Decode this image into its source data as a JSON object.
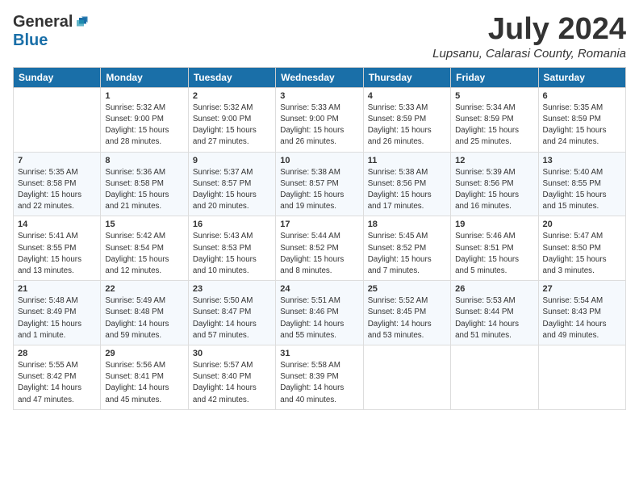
{
  "header": {
    "logo_general": "General",
    "logo_blue": "Blue",
    "month": "July 2024",
    "location": "Lupsanu, Calarasi County, Romania"
  },
  "days_of_week": [
    "Sunday",
    "Monday",
    "Tuesday",
    "Wednesday",
    "Thursday",
    "Friday",
    "Saturday"
  ],
  "weeks": [
    [
      {
        "day": "",
        "info": ""
      },
      {
        "day": "1",
        "info": "Sunrise: 5:32 AM\nSunset: 9:00 PM\nDaylight: 15 hours\nand 28 minutes."
      },
      {
        "day": "2",
        "info": "Sunrise: 5:32 AM\nSunset: 9:00 PM\nDaylight: 15 hours\nand 27 minutes."
      },
      {
        "day": "3",
        "info": "Sunrise: 5:33 AM\nSunset: 9:00 PM\nDaylight: 15 hours\nand 26 minutes."
      },
      {
        "day": "4",
        "info": "Sunrise: 5:33 AM\nSunset: 8:59 PM\nDaylight: 15 hours\nand 26 minutes."
      },
      {
        "day": "5",
        "info": "Sunrise: 5:34 AM\nSunset: 8:59 PM\nDaylight: 15 hours\nand 25 minutes."
      },
      {
        "day": "6",
        "info": "Sunrise: 5:35 AM\nSunset: 8:59 PM\nDaylight: 15 hours\nand 24 minutes."
      }
    ],
    [
      {
        "day": "7",
        "info": "Sunrise: 5:35 AM\nSunset: 8:58 PM\nDaylight: 15 hours\nand 22 minutes."
      },
      {
        "day": "8",
        "info": "Sunrise: 5:36 AM\nSunset: 8:58 PM\nDaylight: 15 hours\nand 21 minutes."
      },
      {
        "day": "9",
        "info": "Sunrise: 5:37 AM\nSunset: 8:57 PM\nDaylight: 15 hours\nand 20 minutes."
      },
      {
        "day": "10",
        "info": "Sunrise: 5:38 AM\nSunset: 8:57 PM\nDaylight: 15 hours\nand 19 minutes."
      },
      {
        "day": "11",
        "info": "Sunrise: 5:38 AM\nSunset: 8:56 PM\nDaylight: 15 hours\nand 17 minutes."
      },
      {
        "day": "12",
        "info": "Sunrise: 5:39 AM\nSunset: 8:56 PM\nDaylight: 15 hours\nand 16 minutes."
      },
      {
        "day": "13",
        "info": "Sunrise: 5:40 AM\nSunset: 8:55 PM\nDaylight: 15 hours\nand 15 minutes."
      }
    ],
    [
      {
        "day": "14",
        "info": "Sunrise: 5:41 AM\nSunset: 8:55 PM\nDaylight: 15 hours\nand 13 minutes."
      },
      {
        "day": "15",
        "info": "Sunrise: 5:42 AM\nSunset: 8:54 PM\nDaylight: 15 hours\nand 12 minutes."
      },
      {
        "day": "16",
        "info": "Sunrise: 5:43 AM\nSunset: 8:53 PM\nDaylight: 15 hours\nand 10 minutes."
      },
      {
        "day": "17",
        "info": "Sunrise: 5:44 AM\nSunset: 8:52 PM\nDaylight: 15 hours\nand 8 minutes."
      },
      {
        "day": "18",
        "info": "Sunrise: 5:45 AM\nSunset: 8:52 PM\nDaylight: 15 hours\nand 7 minutes."
      },
      {
        "day": "19",
        "info": "Sunrise: 5:46 AM\nSunset: 8:51 PM\nDaylight: 15 hours\nand 5 minutes."
      },
      {
        "day": "20",
        "info": "Sunrise: 5:47 AM\nSunset: 8:50 PM\nDaylight: 15 hours\nand 3 minutes."
      }
    ],
    [
      {
        "day": "21",
        "info": "Sunrise: 5:48 AM\nSunset: 8:49 PM\nDaylight: 15 hours\nand 1 minute."
      },
      {
        "day": "22",
        "info": "Sunrise: 5:49 AM\nSunset: 8:48 PM\nDaylight: 14 hours\nand 59 minutes."
      },
      {
        "day": "23",
        "info": "Sunrise: 5:50 AM\nSunset: 8:47 PM\nDaylight: 14 hours\nand 57 minutes."
      },
      {
        "day": "24",
        "info": "Sunrise: 5:51 AM\nSunset: 8:46 PM\nDaylight: 14 hours\nand 55 minutes."
      },
      {
        "day": "25",
        "info": "Sunrise: 5:52 AM\nSunset: 8:45 PM\nDaylight: 14 hours\nand 53 minutes."
      },
      {
        "day": "26",
        "info": "Sunrise: 5:53 AM\nSunset: 8:44 PM\nDaylight: 14 hours\nand 51 minutes."
      },
      {
        "day": "27",
        "info": "Sunrise: 5:54 AM\nSunset: 8:43 PM\nDaylight: 14 hours\nand 49 minutes."
      }
    ],
    [
      {
        "day": "28",
        "info": "Sunrise: 5:55 AM\nSunset: 8:42 PM\nDaylight: 14 hours\nand 47 minutes."
      },
      {
        "day": "29",
        "info": "Sunrise: 5:56 AM\nSunset: 8:41 PM\nDaylight: 14 hours\nand 45 minutes."
      },
      {
        "day": "30",
        "info": "Sunrise: 5:57 AM\nSunset: 8:40 PM\nDaylight: 14 hours\nand 42 minutes."
      },
      {
        "day": "31",
        "info": "Sunrise: 5:58 AM\nSunset: 8:39 PM\nDaylight: 14 hours\nand 40 minutes."
      },
      {
        "day": "",
        "info": ""
      },
      {
        "day": "",
        "info": ""
      },
      {
        "day": "",
        "info": ""
      }
    ]
  ]
}
